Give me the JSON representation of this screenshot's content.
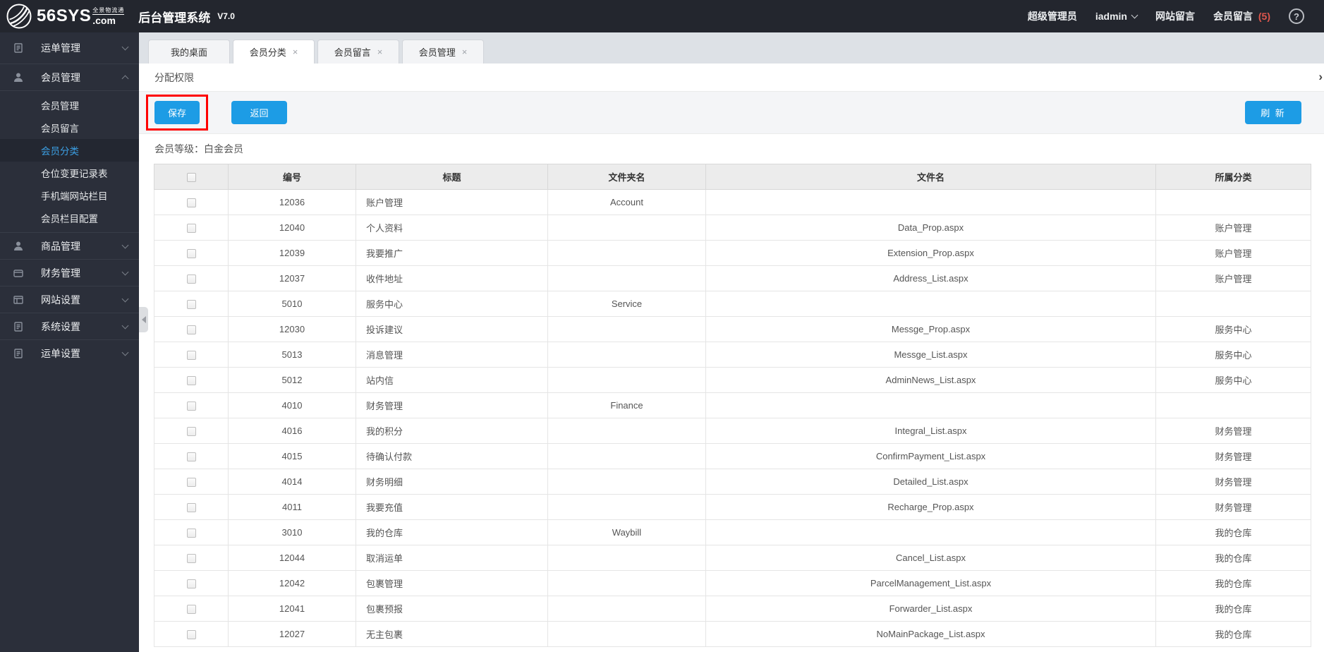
{
  "topbar": {
    "logo": {
      "name": "56SYS",
      "tld": ".com",
      "tagline": "全景物流通"
    },
    "title": "后台管理系统",
    "version": "V7.0",
    "role": "超级管理员",
    "username": "iadmin",
    "site_messages": "网站留言",
    "member_messages": "会员留言",
    "member_messages_count": "(5)",
    "help_label": "?"
  },
  "sidebar": {
    "items": [
      {
        "label": "运单管理"
      },
      {
        "label": "会员管理",
        "children": [
          "会员管理",
          "会员留言",
          "会员分类",
          "仓位变更记录表",
          "手机端网站栏目",
          "会员栏目配置"
        ]
      },
      {
        "label": "商品管理"
      },
      {
        "label": "财务管理"
      },
      {
        "label": "网站设置"
      },
      {
        "label": "系统设置"
      },
      {
        "label": "运单设置"
      }
    ],
    "active_child": "会员分类"
  },
  "tabs": [
    {
      "label": "我的桌面",
      "closable": false,
      "active": false
    },
    {
      "label": "会员分类",
      "closable": true,
      "active": true
    },
    {
      "label": "会员留言",
      "closable": true,
      "active": false
    },
    {
      "label": "会员管理",
      "closable": true,
      "active": false
    }
  ],
  "panel": {
    "title": "分配权限",
    "collapse_icon": "›"
  },
  "toolbar": {
    "save": "保存",
    "back": "返回",
    "refresh": "刷 新"
  },
  "member_level": {
    "label": "会员等级：白金会员"
  },
  "table": {
    "columns": [
      "编号",
      "标题",
      "文件夹名",
      "文件名",
      "所属分类"
    ],
    "rows": [
      {
        "id": "12036",
        "title": "账户管理",
        "folder": "Account",
        "file": "",
        "category": ""
      },
      {
        "id": "12040",
        "title": "个人资料",
        "folder": "",
        "file": "Data_Prop.aspx",
        "category": "账户管理"
      },
      {
        "id": "12039",
        "title": "我要推广",
        "folder": "",
        "file": "Extension_Prop.aspx",
        "category": "账户管理"
      },
      {
        "id": "12037",
        "title": "收件地址",
        "folder": "",
        "file": "Address_List.aspx",
        "category": "账户管理"
      },
      {
        "id": "5010",
        "title": "服务中心",
        "folder": "Service",
        "file": "",
        "category": ""
      },
      {
        "id": "12030",
        "title": "投诉建议",
        "folder": "",
        "file": "Messge_Prop.aspx",
        "category": "服务中心"
      },
      {
        "id": "5013",
        "title": "消息管理",
        "folder": "",
        "file": "Messge_List.aspx",
        "category": "服务中心"
      },
      {
        "id": "5012",
        "title": "站内信",
        "folder": "",
        "file": "AdminNews_List.aspx",
        "category": "服务中心"
      },
      {
        "id": "4010",
        "title": "财务管理",
        "folder": "Finance",
        "file": "",
        "category": ""
      },
      {
        "id": "4016",
        "title": "我的积分",
        "folder": "",
        "file": "Integral_List.aspx",
        "category": "财务管理"
      },
      {
        "id": "4015",
        "title": "待确认付款",
        "folder": "",
        "file": "ConfirmPayment_List.aspx",
        "category": "财务管理"
      },
      {
        "id": "4014",
        "title": "财务明细",
        "folder": "",
        "file": "Detailed_List.aspx",
        "category": "财务管理"
      },
      {
        "id": "4011",
        "title": "我要充值",
        "folder": "",
        "file": "Recharge_Prop.aspx",
        "category": "财务管理"
      },
      {
        "id": "3010",
        "title": "我的仓库",
        "folder": "Waybill",
        "file": "",
        "category": "我的仓库"
      },
      {
        "id": "12044",
        "title": "取消运单",
        "folder": "",
        "file": "Cancel_List.aspx",
        "category": "我的仓库"
      },
      {
        "id": "12042",
        "title": "包裹管理",
        "folder": "",
        "file": "ParcelManagement_List.aspx",
        "category": "我的仓库"
      },
      {
        "id": "12041",
        "title": "包裹预报",
        "folder": "",
        "file": "Forwarder_List.aspx",
        "category": "我的仓库"
      },
      {
        "id": "12027",
        "title": "无主包裹",
        "folder": "",
        "file": "NoMainPackage_List.aspx",
        "category": "我的仓库"
      }
    ]
  },
  "colors": {
    "accent_blue": "#1d9ce5",
    "annotation_red": "#ff0000",
    "badge_red": "#e0574d"
  }
}
